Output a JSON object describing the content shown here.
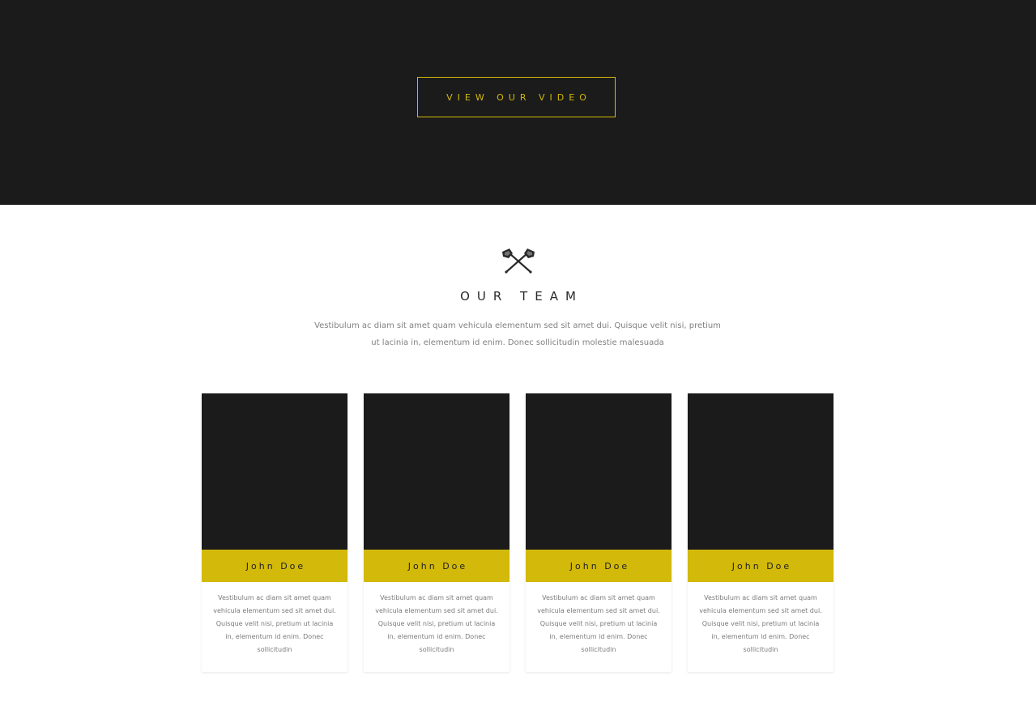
{
  "hero": {
    "video_button_label": "VIEW OUR VIDEO"
  },
  "team": {
    "icon": "crossed-axes-icon",
    "title": "OUR TEAM",
    "intro": "Vestibulum ac diam sit amet quam vehicula elementum sed sit amet dui. Quisque velit nisi, pretium ut lacinia in, elementum id enim. Donec sollicitudin molestie malesuada",
    "members": [
      {
        "name": "John Doe",
        "bio": "Vestibulum ac diam sit amet quam vehicula elementum sed sit amet dui. Quisque velit nisi, pretium ut lacinia in, elementum id enim. Donec sollicitudin"
      },
      {
        "name": "John Doe",
        "bio": "Vestibulum ac diam sit amet quam vehicula elementum sed sit amet dui. Quisque velit nisi, pretium ut lacinia in, elementum id enim. Donec sollicitudin"
      },
      {
        "name": "John Doe",
        "bio": "Vestibulum ac diam sit amet quam vehicula elementum sed sit amet dui. Quisque velit nisi, pretium ut lacinia in, elementum id enim. Donec sollicitudin"
      },
      {
        "name": "John Doe",
        "bio": "Vestibulum ac diam sit amet quam vehicula elementum sed sit amet dui. Quisque velit nisi, pretium ut lacinia in, elementum id enim. Donec sollicitudin"
      }
    ]
  },
  "colors": {
    "dark": "#1b1b1b",
    "accent": "#d2b90a",
    "text_muted": "#808080"
  }
}
